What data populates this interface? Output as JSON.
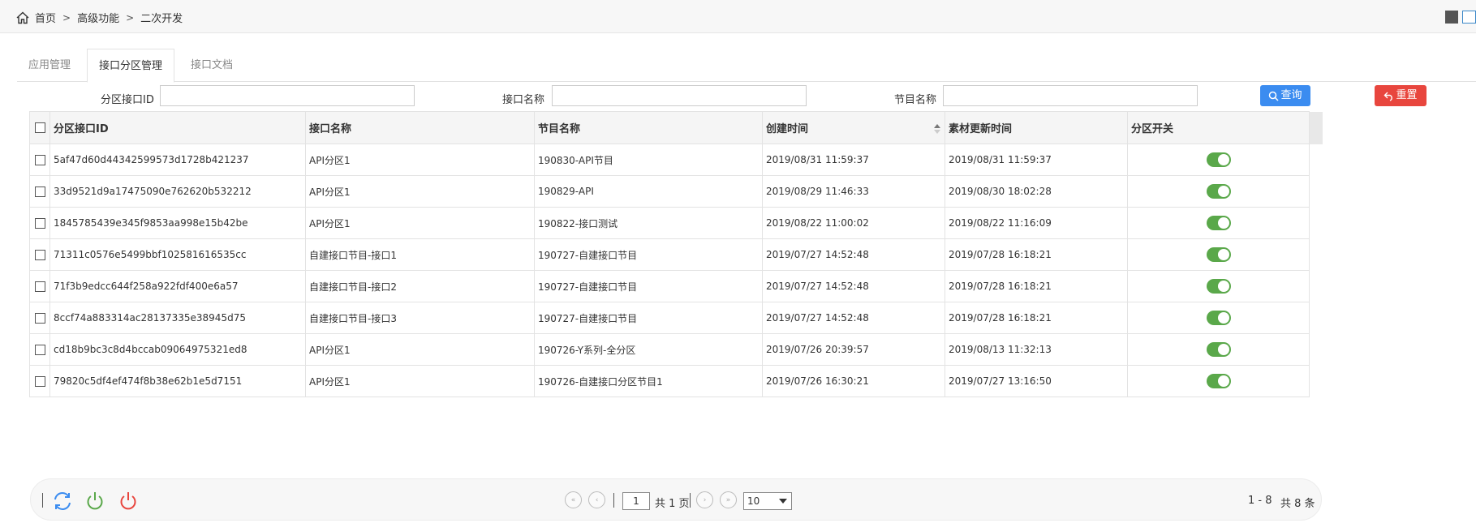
{
  "breadcrumb": {
    "items": [
      "首页",
      "高级功能",
      "二次开发"
    ]
  },
  "tabs": [
    {
      "label": "应用管理"
    },
    {
      "label": "接口分区管理"
    },
    {
      "label": "接口文档"
    }
  ],
  "filters": {
    "partition_id_label": "分区接口ID",
    "partition_id_value": "",
    "interface_name_label": "接口名称",
    "interface_name_value": "",
    "program_name_label": "节目名称",
    "program_name_value": "",
    "query_label": "查询",
    "reset_label": "重置"
  },
  "table": {
    "columns": [
      "分区接口ID",
      "接口名称",
      "节目名称",
      "创建时间",
      "素材更新时间",
      "分区开关"
    ],
    "rows": [
      [
        "5af47d60d44342599573d1728b421237",
        "API分区1",
        "190830-API节目",
        "2019/08/31 11:59:37",
        "2019/08/31 11:59:37"
      ],
      [
        "33d9521d9a17475090e762620b532212",
        "API分区1",
        "190829-API",
        "2019/08/29 11:46:33",
        "2019/08/30 18:02:28"
      ],
      [
        "1845785439e345f9853aa998e15b42be",
        "API分区1",
        "190822-接口测试",
        "2019/08/22 11:00:02",
        "2019/08/22 11:16:09"
      ],
      [
        "71311c0576e5499bbf102581616535cc",
        "自建接口节目-接口1",
        "190727-自建接口节目",
        "2019/07/27 14:52:48",
        "2019/07/28 16:18:21"
      ],
      [
        "71f3b9edcc644f258a922fdf400e6a57",
        "自建接口节目-接口2",
        "190727-自建接口节目",
        "2019/07/27 14:52:48",
        "2019/07/28 16:18:21"
      ],
      [
        "8ccf74a883314ac28137335e38945d75",
        "自建接口节目-接口3",
        "190727-自建接口节目",
        "2019/07/27 14:52:48",
        "2019/07/28 16:18:21"
      ],
      [
        "cd18b9bc3c8d4bccab09064975321ed8",
        "API分区1",
        "190726-Y系列-全分区",
        "2019/07/26 20:39:57",
        "2019/08/13 11:32:13"
      ],
      [
        "79820c5df4ef474f8b38e62b1e5d7151",
        "API分区1",
        "190726-自建接口分区节目1",
        "2019/07/26 16:30:21",
        "2019/07/27 13:16:50"
      ]
    ],
    "switch_on": [
      true,
      true,
      true,
      true,
      true,
      true,
      true,
      true
    ]
  },
  "pager": {
    "current_page": "1",
    "total_pages_text": "共 1 页",
    "page_size": "10",
    "range_text": "1 - 8",
    "total_text": "共 8 条"
  },
  "colors": {
    "query": "#3b8cf0",
    "reset": "#e8463e",
    "switch_on": "#5aa84a",
    "refresh_icon": "#3b8cf0",
    "power_on_icon": "#5aa84a",
    "power_off_icon": "#e8463e"
  }
}
